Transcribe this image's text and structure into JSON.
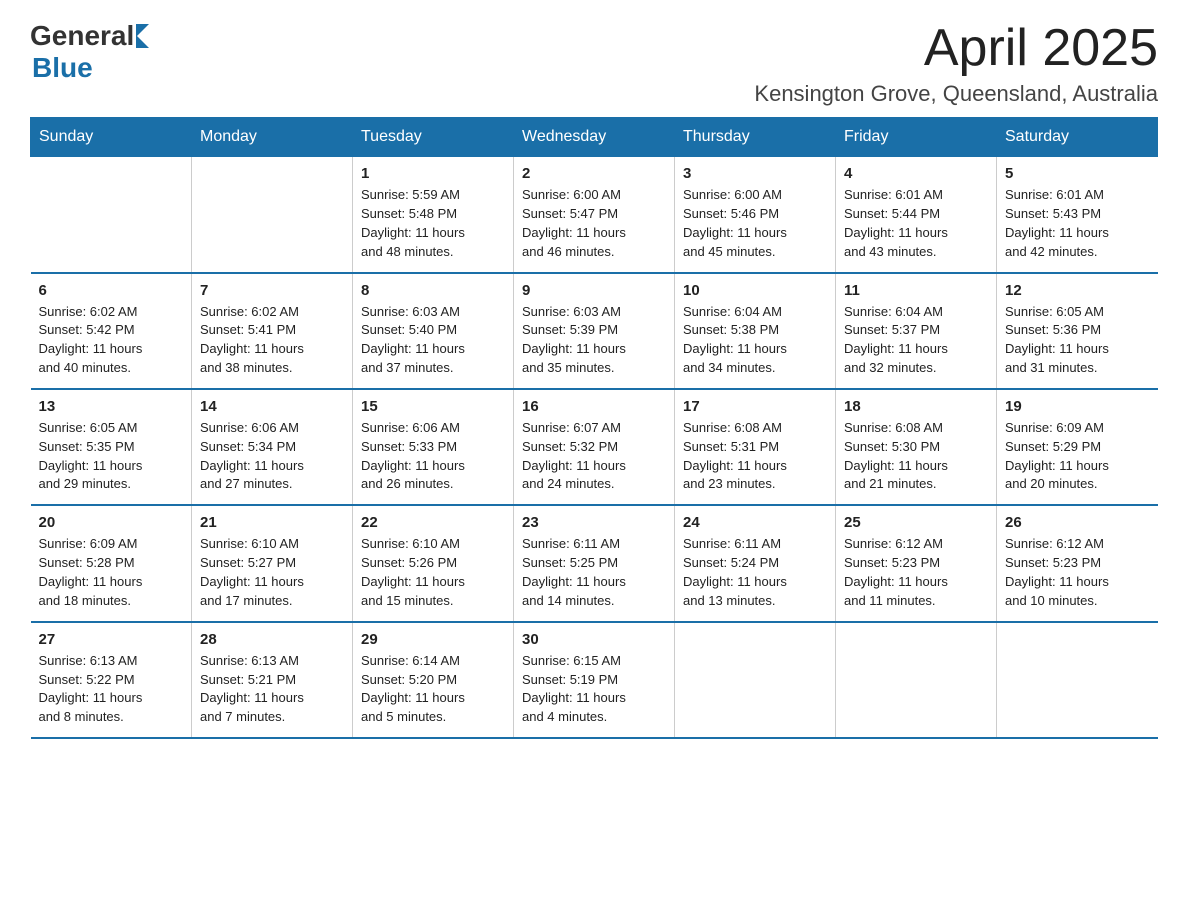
{
  "logo": {
    "general": "General",
    "blue": "Blue"
  },
  "header": {
    "month_year": "April 2025",
    "location": "Kensington Grove, Queensland, Australia"
  },
  "weekdays": [
    "Sunday",
    "Monday",
    "Tuesday",
    "Wednesday",
    "Thursday",
    "Friday",
    "Saturday"
  ],
  "weeks": [
    [
      {
        "day": "",
        "info": ""
      },
      {
        "day": "",
        "info": ""
      },
      {
        "day": "1",
        "info": "Sunrise: 5:59 AM\nSunset: 5:48 PM\nDaylight: 11 hours\nand 48 minutes."
      },
      {
        "day": "2",
        "info": "Sunrise: 6:00 AM\nSunset: 5:47 PM\nDaylight: 11 hours\nand 46 minutes."
      },
      {
        "day": "3",
        "info": "Sunrise: 6:00 AM\nSunset: 5:46 PM\nDaylight: 11 hours\nand 45 minutes."
      },
      {
        "day": "4",
        "info": "Sunrise: 6:01 AM\nSunset: 5:44 PM\nDaylight: 11 hours\nand 43 minutes."
      },
      {
        "day": "5",
        "info": "Sunrise: 6:01 AM\nSunset: 5:43 PM\nDaylight: 11 hours\nand 42 minutes."
      }
    ],
    [
      {
        "day": "6",
        "info": "Sunrise: 6:02 AM\nSunset: 5:42 PM\nDaylight: 11 hours\nand 40 minutes."
      },
      {
        "day": "7",
        "info": "Sunrise: 6:02 AM\nSunset: 5:41 PM\nDaylight: 11 hours\nand 38 minutes."
      },
      {
        "day": "8",
        "info": "Sunrise: 6:03 AM\nSunset: 5:40 PM\nDaylight: 11 hours\nand 37 minutes."
      },
      {
        "day": "9",
        "info": "Sunrise: 6:03 AM\nSunset: 5:39 PM\nDaylight: 11 hours\nand 35 minutes."
      },
      {
        "day": "10",
        "info": "Sunrise: 6:04 AM\nSunset: 5:38 PM\nDaylight: 11 hours\nand 34 minutes."
      },
      {
        "day": "11",
        "info": "Sunrise: 6:04 AM\nSunset: 5:37 PM\nDaylight: 11 hours\nand 32 minutes."
      },
      {
        "day": "12",
        "info": "Sunrise: 6:05 AM\nSunset: 5:36 PM\nDaylight: 11 hours\nand 31 minutes."
      }
    ],
    [
      {
        "day": "13",
        "info": "Sunrise: 6:05 AM\nSunset: 5:35 PM\nDaylight: 11 hours\nand 29 minutes."
      },
      {
        "day": "14",
        "info": "Sunrise: 6:06 AM\nSunset: 5:34 PM\nDaylight: 11 hours\nand 27 minutes."
      },
      {
        "day": "15",
        "info": "Sunrise: 6:06 AM\nSunset: 5:33 PM\nDaylight: 11 hours\nand 26 minutes."
      },
      {
        "day": "16",
        "info": "Sunrise: 6:07 AM\nSunset: 5:32 PM\nDaylight: 11 hours\nand 24 minutes."
      },
      {
        "day": "17",
        "info": "Sunrise: 6:08 AM\nSunset: 5:31 PM\nDaylight: 11 hours\nand 23 minutes."
      },
      {
        "day": "18",
        "info": "Sunrise: 6:08 AM\nSunset: 5:30 PM\nDaylight: 11 hours\nand 21 minutes."
      },
      {
        "day": "19",
        "info": "Sunrise: 6:09 AM\nSunset: 5:29 PM\nDaylight: 11 hours\nand 20 minutes."
      }
    ],
    [
      {
        "day": "20",
        "info": "Sunrise: 6:09 AM\nSunset: 5:28 PM\nDaylight: 11 hours\nand 18 minutes."
      },
      {
        "day": "21",
        "info": "Sunrise: 6:10 AM\nSunset: 5:27 PM\nDaylight: 11 hours\nand 17 minutes."
      },
      {
        "day": "22",
        "info": "Sunrise: 6:10 AM\nSunset: 5:26 PM\nDaylight: 11 hours\nand 15 minutes."
      },
      {
        "day": "23",
        "info": "Sunrise: 6:11 AM\nSunset: 5:25 PM\nDaylight: 11 hours\nand 14 minutes."
      },
      {
        "day": "24",
        "info": "Sunrise: 6:11 AM\nSunset: 5:24 PM\nDaylight: 11 hours\nand 13 minutes."
      },
      {
        "day": "25",
        "info": "Sunrise: 6:12 AM\nSunset: 5:23 PM\nDaylight: 11 hours\nand 11 minutes."
      },
      {
        "day": "26",
        "info": "Sunrise: 6:12 AM\nSunset: 5:23 PM\nDaylight: 11 hours\nand 10 minutes."
      }
    ],
    [
      {
        "day": "27",
        "info": "Sunrise: 6:13 AM\nSunset: 5:22 PM\nDaylight: 11 hours\nand 8 minutes."
      },
      {
        "day": "28",
        "info": "Sunrise: 6:13 AM\nSunset: 5:21 PM\nDaylight: 11 hours\nand 7 minutes."
      },
      {
        "day": "29",
        "info": "Sunrise: 6:14 AM\nSunset: 5:20 PM\nDaylight: 11 hours\nand 5 minutes."
      },
      {
        "day": "30",
        "info": "Sunrise: 6:15 AM\nSunset: 5:19 PM\nDaylight: 11 hours\nand 4 minutes."
      },
      {
        "day": "",
        "info": ""
      },
      {
        "day": "",
        "info": ""
      },
      {
        "day": "",
        "info": ""
      }
    ]
  ]
}
